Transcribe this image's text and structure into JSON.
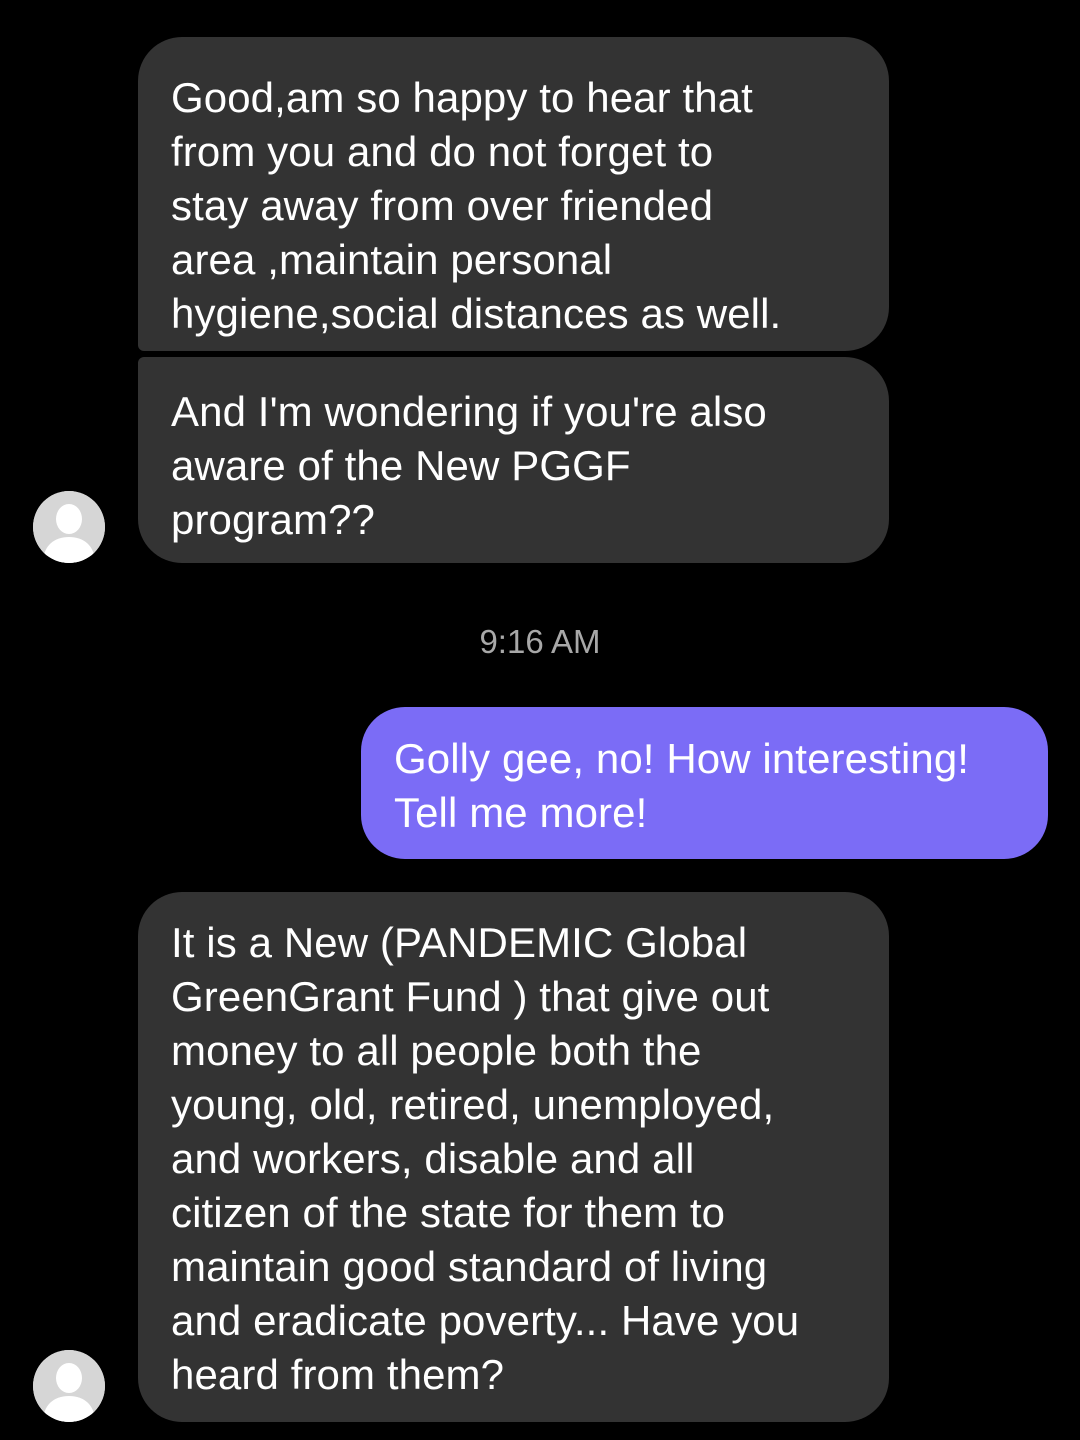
{
  "conversation": {
    "messages": [
      {
        "sender": "contact",
        "text": "Good,am so happy to hear that\nfrom you and do not forget to\nstay away from over friended\narea ,maintain personal\nhygiene,social distances as well."
      },
      {
        "sender": "contact",
        "text": "And I'm wondering if you're also\naware of the New PGGF\nprogram??"
      },
      {
        "sender": "me",
        "text": "Golly gee, no!  How interesting!\nTell me more!"
      },
      {
        "sender": "contact",
        "text": "It is a New (PANDEMIC Global\nGreenGrant Fund ) that give out\nmoney to all people both the\nyoung, old, retired, unemployed,\nand workers, disable and all\ncitizen of the state for them to\nmaintain good standard of living\nand eradicate poverty... Have you\nheard from them?"
      }
    ],
    "timestamp": "9:16 AM"
  },
  "colors": {
    "background": "#000000",
    "incoming_bubble": "#333333",
    "outgoing_bubble": "#7b6cf6",
    "timestamp_text": "#a8a8a8",
    "avatar_bg": "#d6d6d6"
  },
  "icons": {
    "avatar": "default-user-silhouette-icon"
  }
}
